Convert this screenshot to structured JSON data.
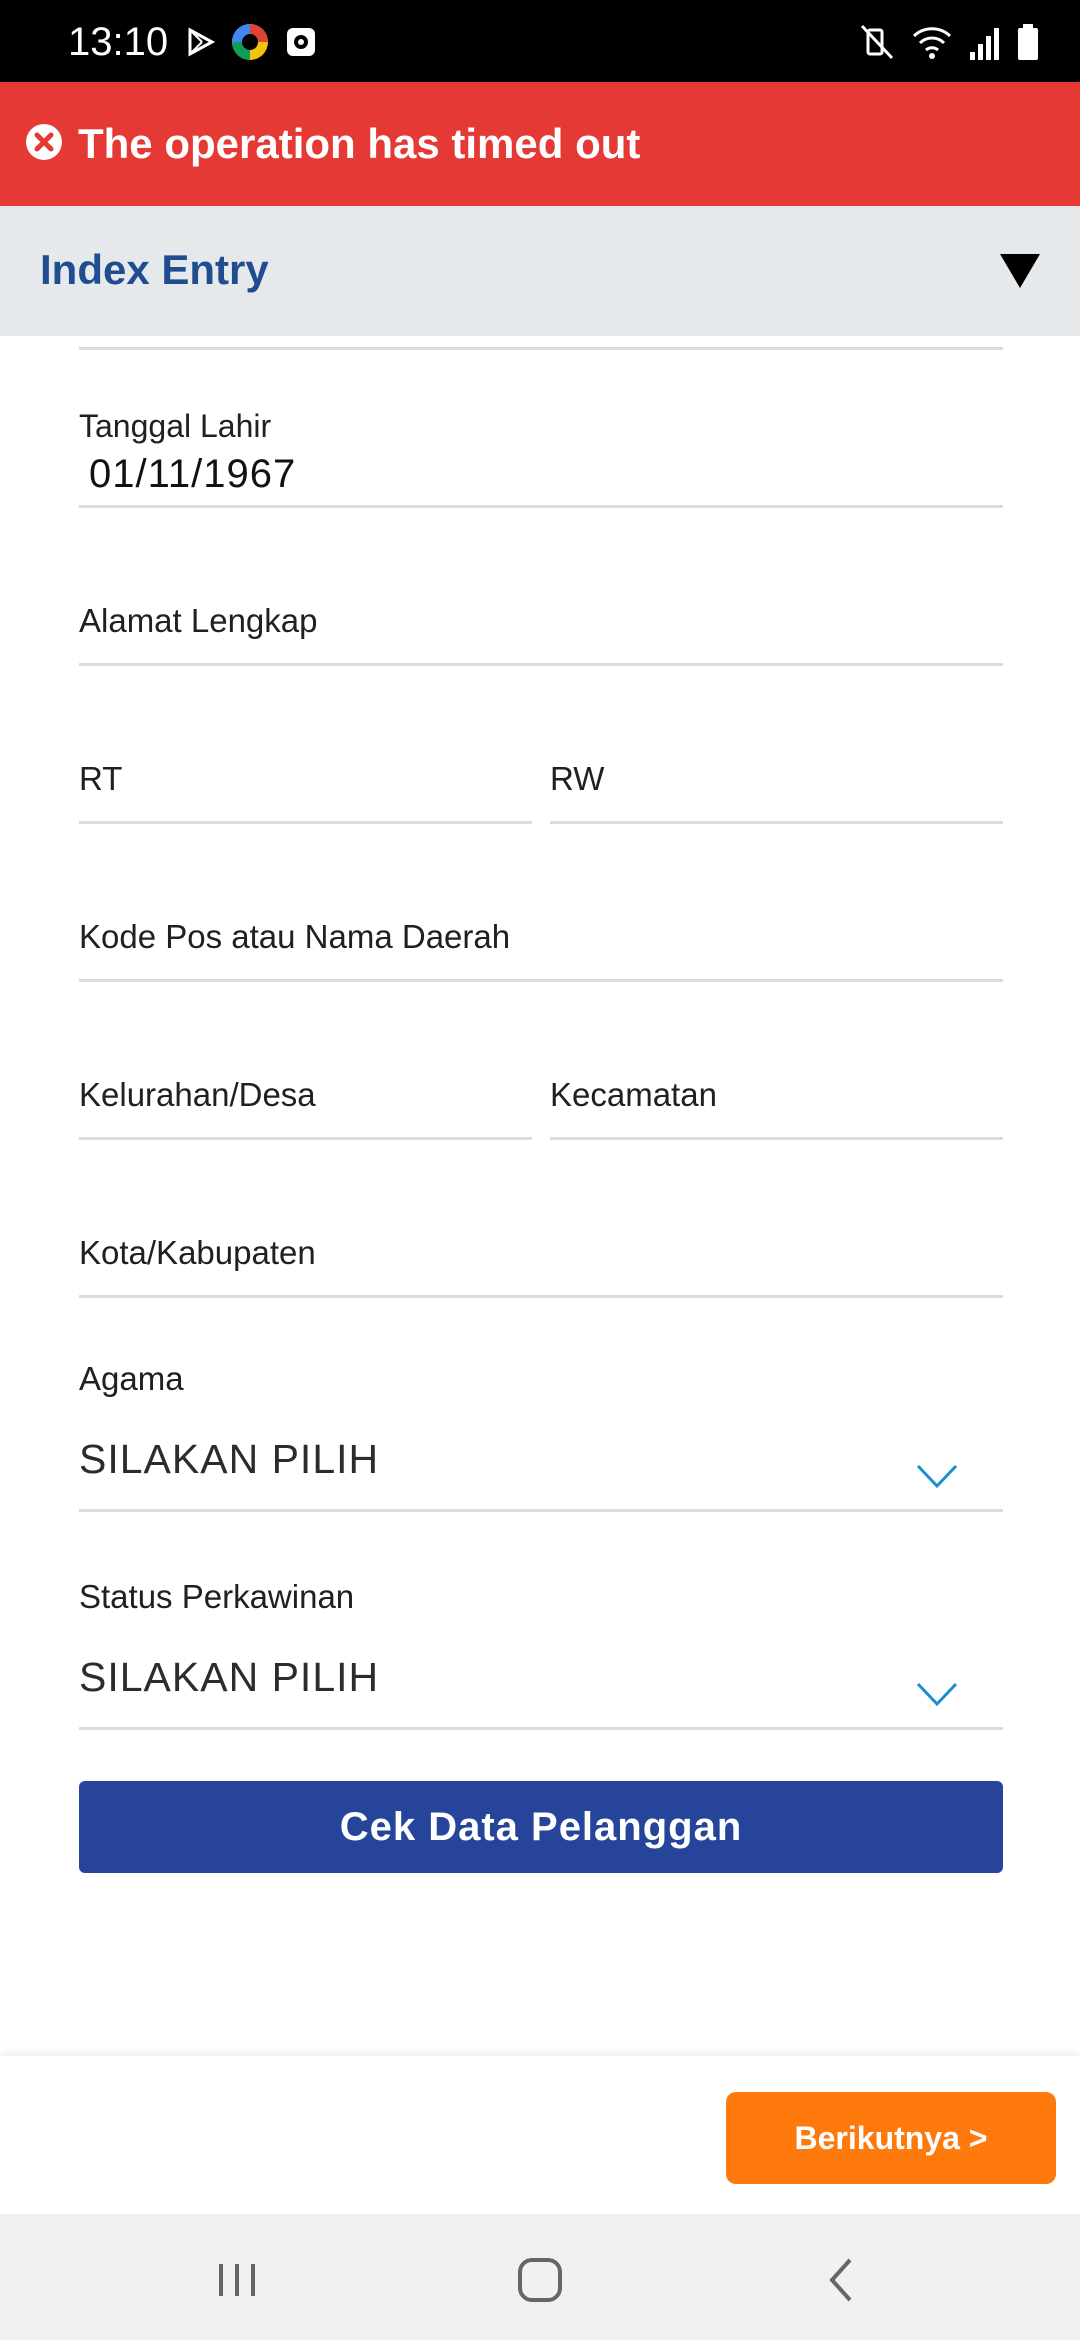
{
  "status_bar": {
    "time": "13:10",
    "left_icons": [
      "play-store-icon",
      "app-icon",
      "camera-app-icon"
    ],
    "right_icons": [
      "mute-vibrate-icon",
      "wifi-icon",
      "signal-icon",
      "battery-icon"
    ]
  },
  "error": {
    "icon": "error-x-icon",
    "message": "The operation has timed out",
    "color": "#e53935"
  },
  "header": {
    "title": "Index Entry",
    "toggle_icon": "triangle-down-icon"
  },
  "form": {
    "birth_date": {
      "label": "Tanggal Lahir",
      "value": "01/11/1967"
    },
    "address": {
      "placeholder": "Alamat Lengkap"
    },
    "rt": {
      "placeholder": "RT"
    },
    "rw": {
      "placeholder": "RW"
    },
    "postal": {
      "placeholder": "Kode Pos atau Nama Daerah"
    },
    "kelurahan": {
      "placeholder": "Kelurahan/Desa"
    },
    "kecamatan": {
      "placeholder": "Kecamatan"
    },
    "kota": {
      "placeholder": "Kota/Kabupaten"
    },
    "religion": {
      "label": "Agama",
      "value": "SILAKAN PILIH"
    },
    "marital": {
      "label": "Status Perkawinan",
      "value": "SILAKAN PILIH"
    }
  },
  "cek_button": {
    "label": "Cek Data Pelanggan",
    "color": "#25449a"
  },
  "next_button": {
    "label": "Berikutnya >",
    "color": "#ff7a0c"
  },
  "nav": {
    "icons": [
      "recent-apps-icon",
      "home-icon",
      "back-icon"
    ]
  }
}
